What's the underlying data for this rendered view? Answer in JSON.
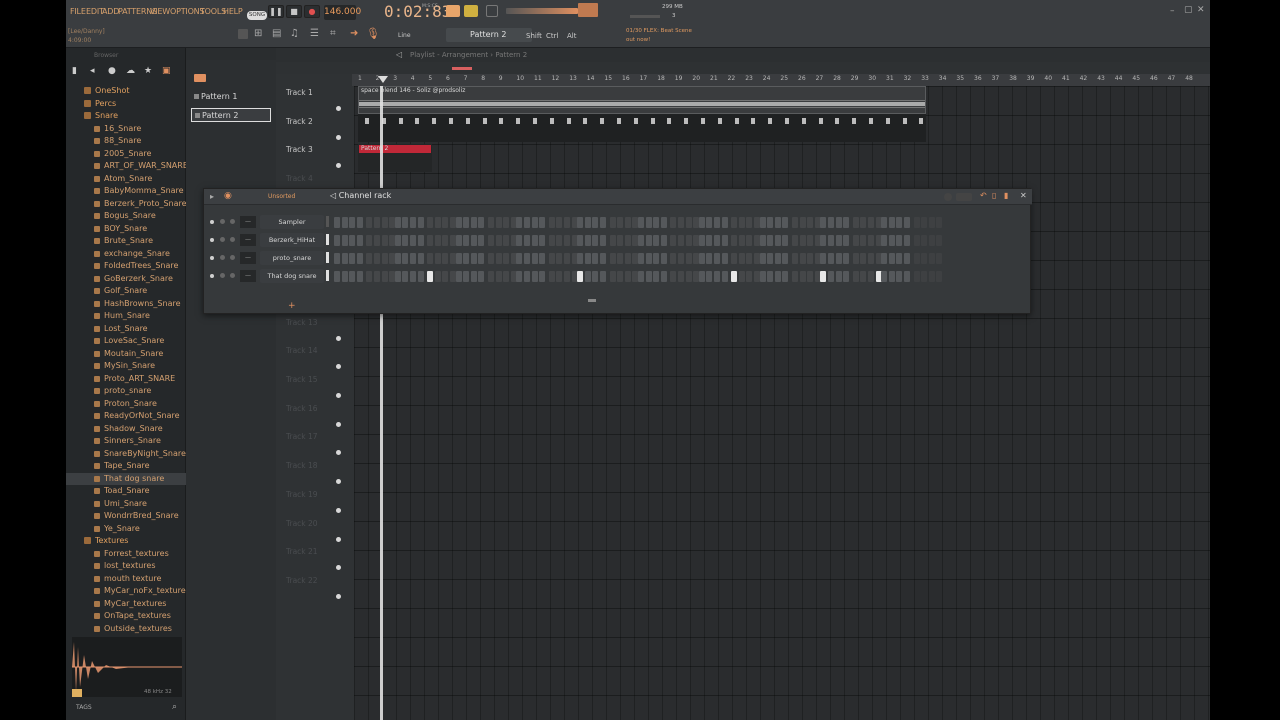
{
  "menu": [
    "FILE",
    "EDIT",
    "ADD",
    "PATTERNS",
    "VIEW",
    "OPTIONS",
    "TOOLS",
    "HELP"
  ],
  "transport": {
    "mode": "SONG",
    "tempo": "146.000",
    "time": "0:02:83",
    "time_unit": "M:S:CS"
  },
  "hint_panel": {
    "name": "[Lee/Danny]",
    "time": "4:09:00"
  },
  "cpu": {
    "memory": "299 MB",
    "polyphony": "3"
  },
  "news": {
    "line1": "01/30  FLEX: Beat Scene",
    "line2": "out now!"
  },
  "toolbar": {
    "snap": "Line",
    "pattern": "Pattern 2",
    "shift": "Shift",
    "ctrl": "Ctrl",
    "alt": "Alt"
  },
  "browser": {
    "title": "Browser",
    "items": [
      {
        "label": "OneShot",
        "type": "folder"
      },
      {
        "label": "Percs",
        "type": "folder"
      },
      {
        "label": "Snare",
        "type": "folder"
      },
      {
        "label": "16_Snare",
        "type": "file"
      },
      {
        "label": "88_Snare",
        "type": "file"
      },
      {
        "label": "2005_Snare",
        "type": "file"
      },
      {
        "label": "ART_OF_WAR_SNARE",
        "type": "file"
      },
      {
        "label": "Atom_Snare",
        "type": "file"
      },
      {
        "label": "BabyMomma_Snare",
        "type": "file"
      },
      {
        "label": "Berzerk_Proto_Snare",
        "type": "file"
      },
      {
        "label": "Bogus_Snare",
        "type": "file"
      },
      {
        "label": "BOY_Snare",
        "type": "file"
      },
      {
        "label": "Brute_Snare",
        "type": "file"
      },
      {
        "label": "exchange_Snare",
        "type": "file"
      },
      {
        "label": "FoldedTrees_Snare",
        "type": "file"
      },
      {
        "label": "GoBerzerk_Snare",
        "type": "file"
      },
      {
        "label": "Golf_Snare",
        "type": "file"
      },
      {
        "label": "HashBrowns_Snare",
        "type": "file"
      },
      {
        "label": "Hum_Snare",
        "type": "file"
      },
      {
        "label": "Lost_Snare",
        "type": "file"
      },
      {
        "label": "LoveSac_Snare",
        "type": "file"
      },
      {
        "label": "Moutain_Snare",
        "type": "file"
      },
      {
        "label": "MySin_Snare",
        "type": "file"
      },
      {
        "label": "Proto_ART_SNARE",
        "type": "file"
      },
      {
        "label": "proto_snare",
        "type": "file"
      },
      {
        "label": "Proton_Snare",
        "type": "file"
      },
      {
        "label": "ReadyOrNot_Snare",
        "type": "file"
      },
      {
        "label": "Shadow_Snare",
        "type": "file"
      },
      {
        "label": "Sinners_Snare",
        "type": "file"
      },
      {
        "label": "SnareByNight_Snare",
        "type": "file"
      },
      {
        "label": "Tape_Snare",
        "type": "file"
      },
      {
        "label": "That dog snare",
        "type": "file",
        "selected": true
      },
      {
        "label": "Toad_Snare",
        "type": "file"
      },
      {
        "label": "Umi_Snare",
        "type": "file"
      },
      {
        "label": "WondrrBred_Snare",
        "type": "file"
      },
      {
        "label": "Ye_Snare",
        "type": "file"
      },
      {
        "label": "Textures",
        "type": "folder"
      },
      {
        "label": "Forrest_textures",
        "type": "file"
      },
      {
        "label": "lost_textures",
        "type": "file"
      },
      {
        "label": "mouth texture",
        "type": "file"
      },
      {
        "label": "MyCar_noFx_textures",
        "type": "file"
      },
      {
        "label": "MyCar_textures",
        "type": "file"
      },
      {
        "label": "OnTape_textures",
        "type": "file"
      },
      {
        "label": "Outside_textures",
        "type": "file"
      }
    ],
    "sample_info": "48 kHz 32",
    "tags": "TAGS"
  },
  "patterns": [
    "Pattern 1",
    "Pattern 2"
  ],
  "playlist": {
    "title": "Playlist - Arrangement",
    "pattern": "Pattern 2",
    "ruler": [
      "1",
      "2",
      "3",
      "4",
      "5",
      "6",
      "7",
      "8",
      "9",
      "10",
      "11",
      "12",
      "13",
      "14",
      "15",
      "16",
      "17",
      "18",
      "19",
      "20",
      "21",
      "22",
      "23",
      "24",
      "25",
      "26",
      "27",
      "28",
      "29",
      "30",
      "31",
      "32",
      "33",
      "34",
      "35",
      "36",
      "37",
      "38",
      "39",
      "40",
      "41",
      "42",
      "43",
      "44",
      "45",
      "46",
      "47",
      "48"
    ],
    "tracks": [
      "Track 1",
      "Track 2",
      "Track 3",
      "Track 4",
      "Track 9",
      "Track 10",
      "Track 11",
      "Track 12",
      "Track 13",
      "Track 14",
      "Track 15",
      "Track 16",
      "Track 17",
      "Track 18",
      "Track 19",
      "Track 20",
      "Track 21",
      "Track 22"
    ],
    "audio_clip": "space blend 146 - Soliz @prodsoliz",
    "pattern_clip": "Pattern 2"
  },
  "channel_rack": {
    "title": "Channel rack",
    "filter": "Unsorted",
    "channels": [
      {
        "name": "Sampler",
        "active_steps": []
      },
      {
        "name": "Berzerk_HiHat",
        "active_steps": []
      },
      {
        "name": "proto_snare",
        "active_steps": []
      },
      {
        "name": "That dog snare",
        "active_steps": [
          12,
          32,
          52,
          64,
          71
        ]
      }
    ]
  }
}
